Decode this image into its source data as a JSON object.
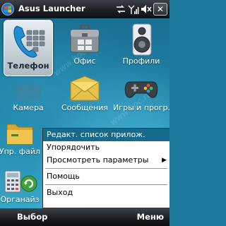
{
  "titlebar": {
    "title": "Asus Launcher",
    "close_label": "✕"
  },
  "tiles": [
    {
      "label": "Телефон",
      "icon": "phone-icon",
      "selected": true
    },
    {
      "label": "Офис",
      "icon": "office-briefcase-icon"
    },
    {
      "label": "Профили",
      "icon": "speaker-icon"
    },
    {
      "label": "Камера",
      "icon": "camera-icon"
    },
    {
      "label": "Сообщения",
      "icon": "envelope-icon"
    },
    {
      "label": "Игры и прогр.",
      "icon": "gamepad-icon"
    },
    {
      "label": "Упр. файл",
      "icon": "folder-icon"
    },
    {
      "label": "Органайз",
      "icon": "calculator-icon"
    }
  ],
  "menu": {
    "items": [
      {
        "label": "Редакт. список прилож.",
        "highlight": true
      },
      {
        "label": "Упорядочить"
      },
      {
        "label": "Просмотреть параметры",
        "submenu": true
      },
      {
        "label": "Помощь"
      },
      {
        "label": "Выход"
      }
    ]
  },
  "softkeys": {
    "left": "Выбор",
    "right": "Меню"
  },
  "watermark": "www.hpc.ru",
  "colors": {
    "accent": "#156a8d",
    "desktop": "#1e7a9c"
  }
}
